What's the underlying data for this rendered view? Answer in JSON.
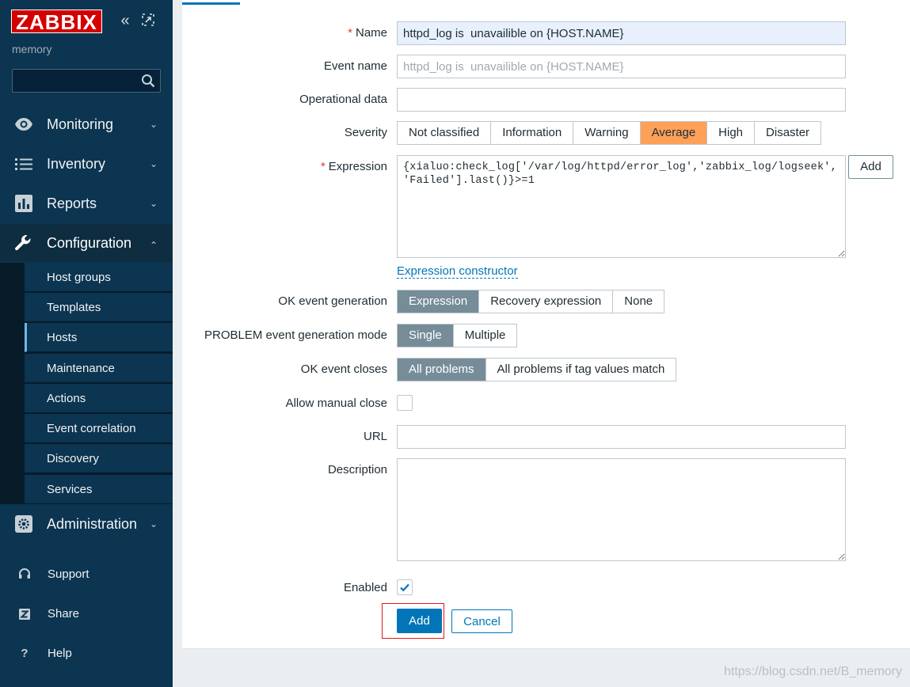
{
  "sidebar": {
    "logo": "ZABBIX",
    "server_name": "memory",
    "search": {
      "value": "",
      "placeholder": ""
    },
    "menu": [
      {
        "label": "Monitoring",
        "icon": "eye-icon"
      },
      {
        "label": "Inventory",
        "icon": "list-icon"
      },
      {
        "label": "Reports",
        "icon": "bar-chart-icon"
      },
      {
        "label": "Configuration",
        "icon": "wrench-icon",
        "expanded": true
      },
      {
        "label": "Administration",
        "icon": "gear-icon"
      }
    ],
    "submenu": [
      {
        "label": "Host groups"
      },
      {
        "label": "Templates"
      },
      {
        "label": "Hosts",
        "active": true
      },
      {
        "label": "Maintenance"
      },
      {
        "label": "Actions"
      },
      {
        "label": "Event correlation"
      },
      {
        "label": "Discovery"
      },
      {
        "label": "Services"
      }
    ],
    "bottom": [
      {
        "label": "Support",
        "icon": "headset-icon"
      },
      {
        "label": "Share",
        "icon": "share-z-icon"
      },
      {
        "label": "Help",
        "icon": "question-icon",
        "glyph": "?"
      }
    ]
  },
  "form": {
    "name": {
      "label": "Name",
      "value": "httpd_log is  unavailible on {HOST.NAME}"
    },
    "event_name": {
      "label": "Event name",
      "value": "",
      "placeholder": "httpd_log is  unavailible on {HOST.NAME}"
    },
    "operational_data": {
      "label": "Operational data",
      "value": ""
    },
    "severity": {
      "label": "Severity",
      "options": [
        "Not classified",
        "Information",
        "Warning",
        "Average",
        "High",
        "Disaster"
      ],
      "selected": "Average"
    },
    "expression": {
      "label": "Expression",
      "value": "{xialuo:check_log['/var/log/httpd/error_log','zabbix_log/logseek','Failed'].last()}>=1",
      "add_label": "Add",
      "constructor_link": "Expression constructor"
    },
    "ok_event_generation": {
      "label": "OK event generation",
      "options": [
        "Expression",
        "Recovery expression",
        "None"
      ],
      "selected": "Expression"
    },
    "problem_mode": {
      "label": "PROBLEM event generation mode",
      "options": [
        "Single",
        "Multiple"
      ],
      "selected": "Single"
    },
    "ok_event_closes": {
      "label": "OK event closes",
      "options": [
        "All problems",
        "All problems if tag values match"
      ],
      "selected": "All problems"
    },
    "allow_manual_close": {
      "label": "Allow manual close",
      "checked": false
    },
    "url": {
      "label": "URL",
      "value": ""
    },
    "description": {
      "label": "Description",
      "value": ""
    },
    "enabled": {
      "label": "Enabled",
      "checked": true
    },
    "buttons": {
      "add": "Add",
      "cancel": "Cancel"
    }
  },
  "colors": {
    "sidebar_bg": "#0b3551",
    "accent": "#0275b8",
    "severity_average": "#ffa059",
    "segment_selected": "#768d99",
    "highlight": "#e0161b"
  },
  "watermark": "https://blog.csdn.net/B_memory"
}
